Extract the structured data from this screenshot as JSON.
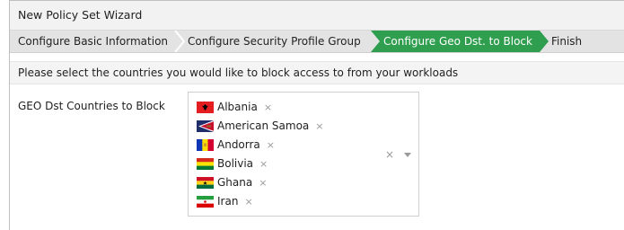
{
  "window": {
    "title": "New Policy Set Wizard"
  },
  "steps": [
    {
      "label": "Configure Basic Information",
      "active": false
    },
    {
      "label": "Configure Security Profile Group",
      "active": false
    },
    {
      "label": "Configure Geo Dst. to Block",
      "active": true
    },
    {
      "label": "Finish",
      "active": false
    }
  ],
  "instruction": "Please select the countries you would like to block access to from your workloads",
  "geo_field": {
    "label": "GEO Dst Countries to Block",
    "selected": [
      {
        "name": "Albania",
        "flag": "albania-flag-icon"
      },
      {
        "name": "American Samoa",
        "flag": "american-samoa-flag-icon"
      },
      {
        "name": "Andorra",
        "flag": "andorra-flag-icon"
      },
      {
        "name": "Bolivia",
        "flag": "bolivia-flag-icon"
      },
      {
        "name": "Ghana",
        "flag": "ghana-flag-icon"
      },
      {
        "name": "Iran",
        "flag": "iran-flag-icon"
      }
    ],
    "remove_symbol": "×",
    "clear_symbol": "×"
  },
  "colors": {
    "active_step": "#2f9e4f",
    "step_bg": "#e3e3e3"
  }
}
